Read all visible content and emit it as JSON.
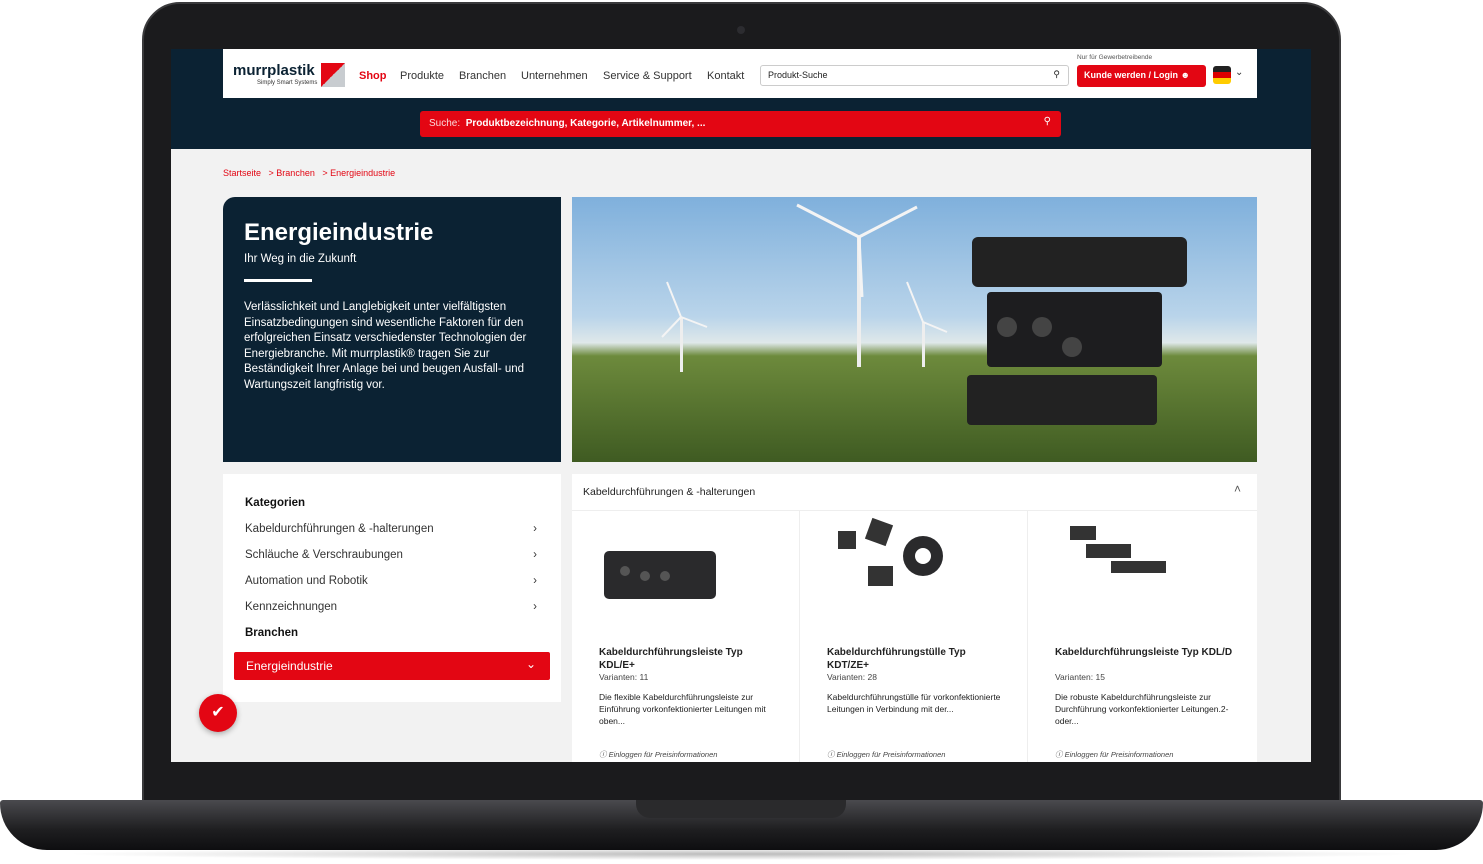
{
  "nav": {
    "logo": "murrplastik",
    "logo_sub": "Simply Smart Systems",
    "items": [
      "Shop",
      "Produkte",
      "Branchen",
      "Unternehmen",
      "Service & Support",
      "Kontakt"
    ],
    "search_placeholder": "Produkt-Suche",
    "gewerbe_note": "Nur für Gewerbetreibende",
    "login": "Kunde werden / Login"
  },
  "searchbar": {
    "label": "Suche:",
    "placeholder": "Produktbezeichnung, Kategorie, Artikelnummer, ..."
  },
  "breadcrumb": [
    "Startseite",
    "> Branchen",
    "> Energieindustrie"
  ],
  "hero": {
    "title": "Energieindustrie",
    "subtitle": "Ihr Weg in die Zukunft",
    "text": "Verlässlichkeit und Langlebigkeit unter vielfältigsten Einsatzbedingungen sind wesentliche Faktoren für den erfolgreichen Einsatz verschiedenster Technologien der Energiebranche. Mit murrplastik® tragen Sie zur Beständigkeit Ihrer Anlage bei und beugen Ausfall- und Wartungszeit langfristig vor."
  },
  "sidebar": {
    "kategorien": "Kategorien",
    "items": [
      "Kabeldurchführungen & -halterungen",
      "Schläuche & Verschraubungen",
      "Automation und Robotik",
      "Kennzeichnungen"
    ],
    "branchen": "Branchen",
    "active": "Energieindustrie"
  },
  "products": {
    "header": "Kabeldurchführungen & -halterungen",
    "items": [
      {
        "title": "Kabeldurchführungsleiste Typ KDL/E+",
        "variants": "Varianten: 11",
        "desc": "Die flexible Kabeldurchführungsleiste zur Einführung vorkonfektionierter Leitungen mit oben...",
        "price": "Einloggen für Preisinformationen"
      },
      {
        "title": "Kabeldurchführungstülle Typ KDT/ZE+",
        "variants": "Varianten: 28",
        "desc": "Kabeldurchführungstülle für vorkonfektionierte Leitungen in Verbindung mit der...",
        "price": "Einloggen für Preisinformationen"
      },
      {
        "title": "Kabeldurchführungsleiste Typ KDL/D",
        "variants": "Varianten: 15",
        "desc": "Die robuste Kabeldurchführungsleiste zur Durchführung vorkonfektionierter Leitungen.2- oder...",
        "price": "Einloggen für Preisinformationen"
      }
    ]
  },
  "colors": {
    "brand_red": "#e30613",
    "navy": "#0b2233"
  }
}
